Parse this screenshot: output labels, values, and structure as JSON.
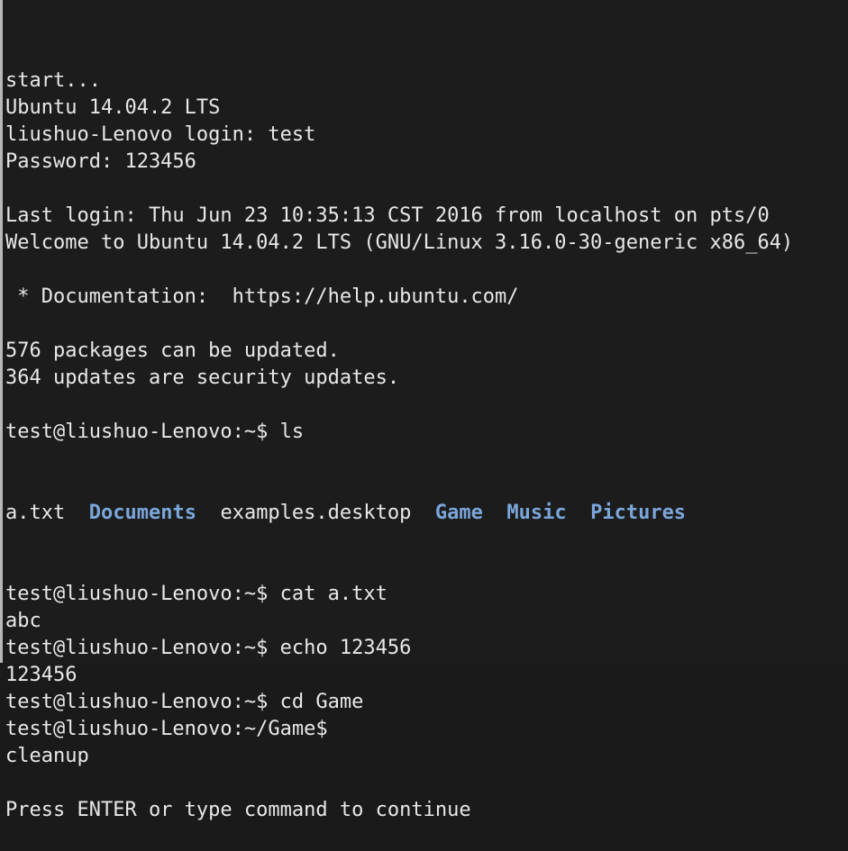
{
  "lines": [
    {
      "text": "start..."
    },
    {
      "text": "Ubuntu 14.04.2 LTS"
    },
    {
      "text": "liushuo-Lenovo login: test"
    },
    {
      "text": "Password: 123456"
    },
    {
      "text": ""
    },
    {
      "text": "Last login: Thu Jun 23 10:35:13 CST 2016 from localhost on pts/0"
    },
    {
      "text": "Welcome to Ubuntu 14.04.2 LTS (GNU/Linux 3.16.0-30-generic x86_64)"
    },
    {
      "text": ""
    },
    {
      "text": " * Documentation:  https://help.ubuntu.com/"
    },
    {
      "text": ""
    },
    {
      "text": "576 packages can be updated."
    },
    {
      "text": "364 updates are security updates."
    },
    {
      "text": ""
    },
    {
      "text": "test@liushuo-Lenovo:~$ ls"
    }
  ],
  "ls_output": {
    "items": [
      {
        "name": "a.txt",
        "type": "file"
      },
      {
        "name": "Documents",
        "type": "dir"
      },
      {
        "name": "examples.desktop",
        "type": "file"
      },
      {
        "name": "Game",
        "type": "dir"
      },
      {
        "name": "Music",
        "type": "dir"
      },
      {
        "name": "Pictures",
        "type": "dir"
      }
    ]
  },
  "lines_after": [
    {
      "text": "test@liushuo-Lenovo:~$ cat a.txt"
    },
    {
      "text": "abc"
    },
    {
      "text": "test@liushuo-Lenovo:~$ echo 123456"
    },
    {
      "text": "123456"
    },
    {
      "text": "test@liushuo-Lenovo:~$ cd Game"
    },
    {
      "text": "test@liushuo-Lenovo:~/Game$"
    },
    {
      "text": "cleanup"
    },
    {
      "text": ""
    },
    {
      "text": "Press ENTER or type command to continue"
    }
  ],
  "colors": {
    "background": "#1c1c1c",
    "foreground": "#e8e8e8",
    "directory": "#7aa6da"
  }
}
